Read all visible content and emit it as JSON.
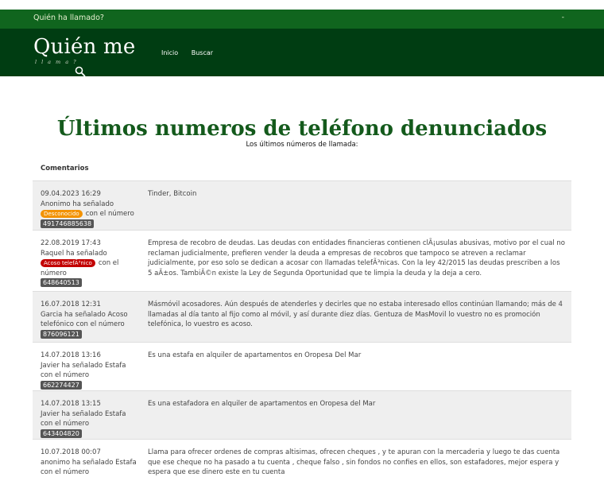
{
  "topbar": {
    "site_link": "Quién ha llamado?",
    "dot": "-"
  },
  "header": {
    "logo": "Quién me",
    "logo_sub": "llama?",
    "nav": [
      "Inicio",
      "Buscar"
    ]
  },
  "page": {
    "title": "Últimos numeros de teléfono denunciados",
    "subtitle": "Los últimos números de llamada:",
    "comments_head": "Comentarios"
  },
  "rows": [
    {
      "date": "09.04.2023 16:29",
      "who": "Anonimo ha señalado",
      "badge": "Desconocido",
      "badge_color": "#f39200",
      "tail": "con el número",
      "number": "491746885638",
      "comment": "Tinder, Bitcoin",
      "height": 62
    },
    {
      "date": "22.08.2019 17:43",
      "who": "Raquel ha señalado",
      "badge": "Acoso telefÃ³nico",
      "badge_color": "#c30000",
      "tail": "con el número",
      "number": "648640513",
      "comment": "Empresa de recobro de deudas. Las deudas con entidades financieras contienen clÃ¡usulas abusivas, motivo por el cual no reclaman judicialmente, prefieren vender la deuda a empresas de recobros que tampoco se atreven a reclamar judicialmente, por eso solo se dedican a acosar con llamadas telefÃ³nicas. Con la ley 42/2015 las deudas prescriben a los 5 aÃ±os. TambiÃ©n existe la Ley de Segunda Oportunidad que te limpia la deuda y la deja a cero.",
      "height": 77
    },
    {
      "date": "16.07.2018 12:31",
      "who": "Garcia ha señalado Acoso telefónico con el número",
      "badge": "",
      "badge_color": "",
      "tail": "",
      "number": "876096121",
      "comment": "Másmóvil acosadores. Aún después de atenderles y decirles que no estaba interesado ellos continúan llamando; más de 4 llamadas al día tanto al fijo como al móvil, y así durante diez días. Gentuza de MasMovil lo vuestro no es promoción telefónica, lo vuestro es acoso.",
      "height": 64
    },
    {
      "date": "14.07.2018 13:16",
      "who": "Javier ha señalado Estafa con el número",
      "badge": "",
      "badge_color": "",
      "tail": "",
      "number": "662274427",
      "comment": "Es una estafa en alquiler de apartamentos en Oropesa Del Mar",
      "height": 61
    },
    {
      "date": "14.07.2018 13:15",
      "who": "Javier ha señalado Estafa con el número",
      "badge": "",
      "badge_color": "",
      "tail": "",
      "number": "643404820",
      "comment": "Es una estafadora en alquiler de apartamentos en Oropesa del Mar",
      "height": 61
    },
    {
      "date": "10.07.2018 00:07",
      "who": "anonimo ha señalado Estafa con el número",
      "badge": "",
      "badge_color": "",
      "tail": "",
      "number": "",
      "comment": "Llama para ofrecer ordenes de compras altisimas, ofrecen cheques , y te apuran con la mercaderia y luego te das cuenta que ese cheque no ha pasado a tu cuenta , cheque falso , sin fondos no confies en ellos, son estafadores, mejor espera y espera que ese dinero este en tu cuenta",
      "height": 60
    }
  ],
  "colors": {
    "topbar": "#10651e",
    "header": "#003d12",
    "title": "#145a1c",
    "badge_orange": "#f39200",
    "badge_red": "#c30000"
  }
}
